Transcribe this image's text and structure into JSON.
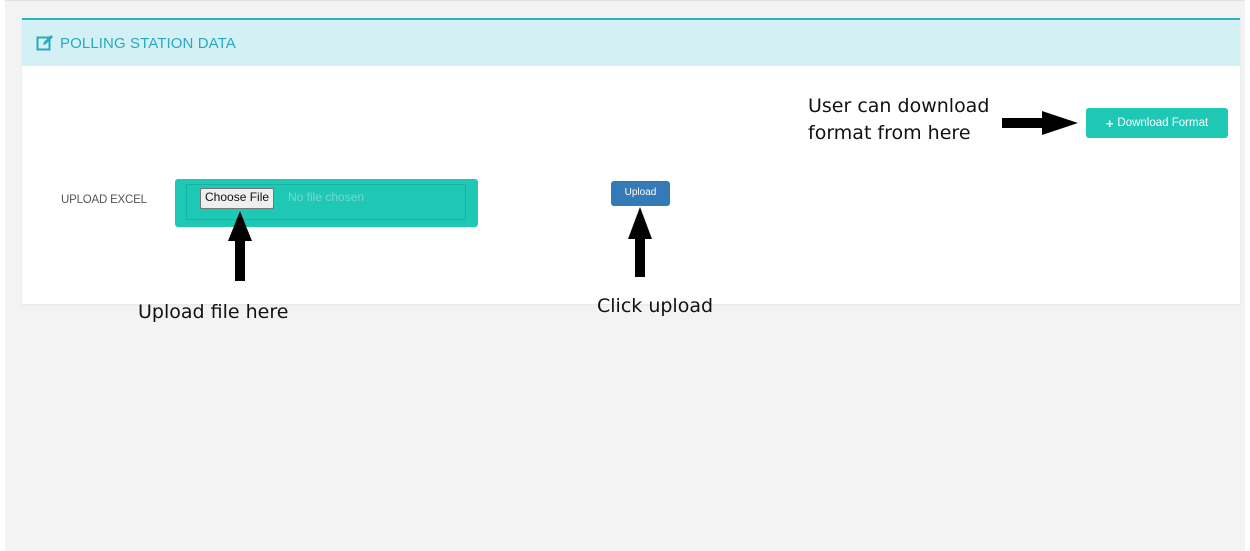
{
  "panel": {
    "title": "POLLING STATION DATA",
    "icon": "edit-icon",
    "accent_color": "#29b6c6",
    "header_bg": "#d3f1f4"
  },
  "upload_form": {
    "label": "UPLOAD EXCEL",
    "choose_file_label": "Choose File",
    "no_file_text": "No file chosen",
    "upload_label": "Upload",
    "upload_color": "#337ab7",
    "file_box_color": "#1ec8b4"
  },
  "download": {
    "label": "Download Format",
    "icon": "plus-icon",
    "color": "#1ec8b4"
  },
  "annotations": {
    "download_line1": "User can download",
    "download_line2": "format from here",
    "upload_file": "Upload file here",
    "click_upload": "Click upload"
  }
}
